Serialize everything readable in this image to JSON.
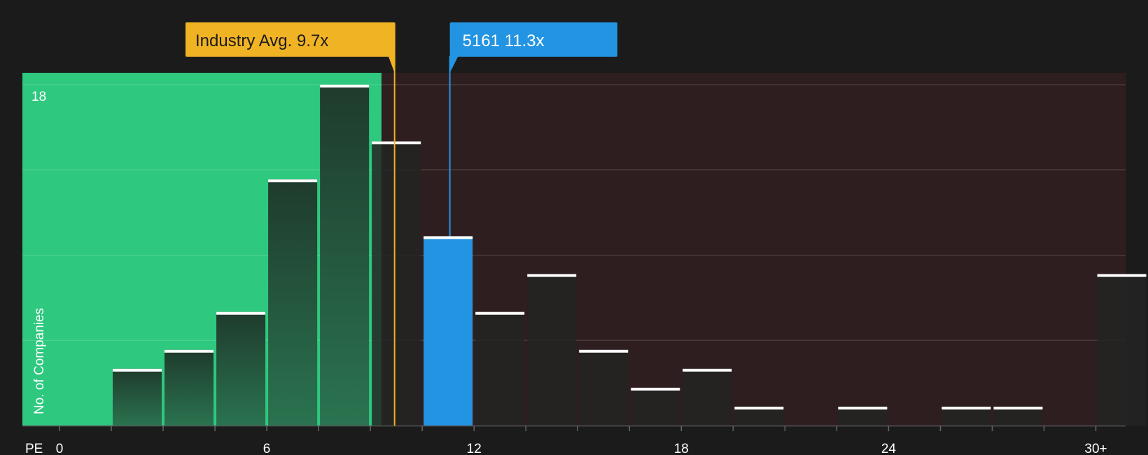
{
  "chart_data": {
    "type": "bar",
    "xlabel": "PE",
    "ylabel": "No. of Companies",
    "y_max_label": "18",
    "ylim": [
      0,
      18
    ],
    "xlim": [
      0,
      31
    ],
    "x_ticks": [
      {
        "value": 0,
        "label": "0"
      },
      {
        "value": 6,
        "label": "6"
      },
      {
        "value": 12,
        "label": "12"
      },
      {
        "value": 18,
        "label": "18"
      },
      {
        "value": 24,
        "label": "24"
      },
      {
        "value": 30,
        "label": "30+"
      }
    ],
    "bin_width": 1.5,
    "bins": [
      {
        "start": 1.5,
        "count": 3
      },
      {
        "start": 3.0,
        "count": 4
      },
      {
        "start": 4.5,
        "count": 6
      },
      {
        "start": 6.0,
        "count": 13
      },
      {
        "start": 7.5,
        "count": 18
      },
      {
        "start": 9.0,
        "count": 15
      },
      {
        "start": 10.5,
        "count": 10,
        "highlight": true
      },
      {
        "start": 12.0,
        "count": 6
      },
      {
        "start": 13.5,
        "count": 8
      },
      {
        "start": 15.0,
        "count": 4
      },
      {
        "start": 16.5,
        "count": 2
      },
      {
        "start": 18.0,
        "count": 3
      },
      {
        "start": 19.5,
        "count": 1
      },
      {
        "start": 22.5,
        "count": 1
      },
      {
        "start": 25.5,
        "count": 1
      },
      {
        "start": 27.0,
        "count": 1
      },
      {
        "start": 30.0,
        "count": 8
      }
    ],
    "industry_avg": {
      "value": 9.7,
      "label": "Industry Avg. 9.7x"
    },
    "company": {
      "value": 11.3,
      "label": "5161 11.3x"
    },
    "colors": {
      "background": "#1b1b1b",
      "undervalued_zone": "#2ec87e",
      "overvalued_zone": "#2f1e1f",
      "industry": "#f0b323",
      "company": "#2394e2",
      "bar_dark": "#232323",
      "bar_green": "#22472f"
    }
  }
}
